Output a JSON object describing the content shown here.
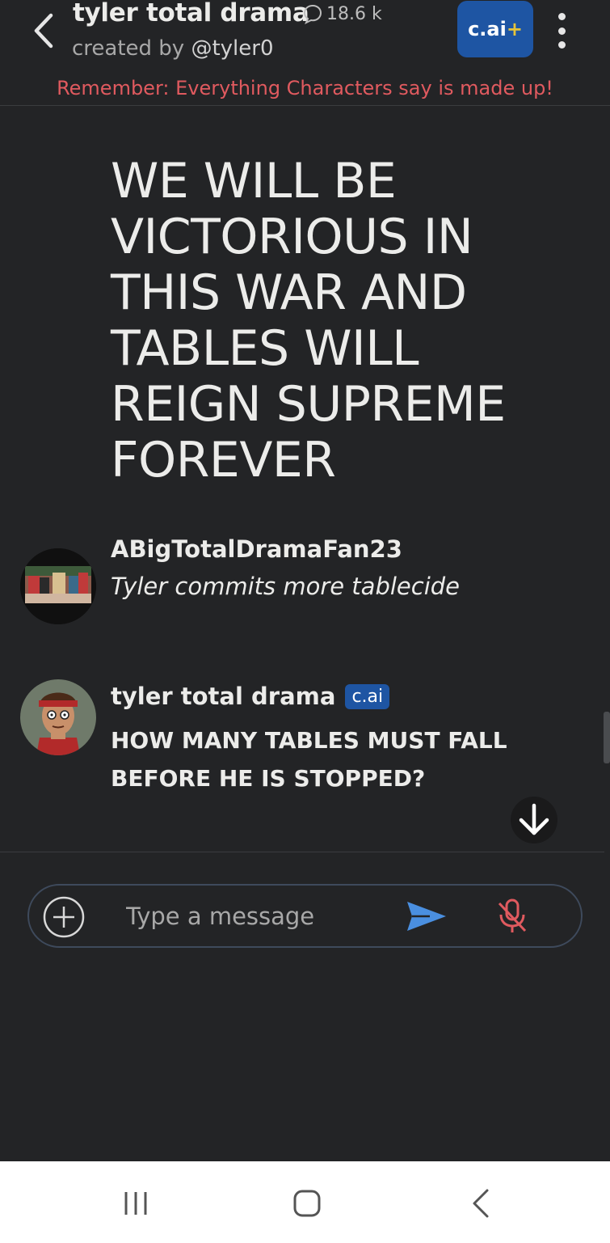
{
  "header": {
    "character_name": "tyler total drama",
    "chat_count": "18.6 k",
    "created_by_prefix": "created by",
    "creator_handle": "@tyler0",
    "subscribe_label": "c.ai",
    "subscribe_plus": "+",
    "disclaimer": "Remember: Everything Characters say is made up!"
  },
  "messages": [
    {
      "type": "bot-large",
      "text": "WE WILL BE VICTORIOUS IN THIS WAR AND TABLES WILL REIGN SUPREME FOREVER"
    },
    {
      "type": "user",
      "sender": "ABigTotalDramaFan23",
      "text": "Tyler commits more tablecide"
    },
    {
      "type": "bot",
      "sender": "tyler total drama",
      "badge": "c.ai",
      "text": "HOW MANY TABLES MUST FALL BEFORE HE IS STOPPED?"
    }
  ],
  "composer": {
    "placeholder": "Type a message"
  },
  "icons": {
    "back": "chevron-left-icon",
    "chat": "chat-bubble-icon",
    "menu": "kebab-menu-icon",
    "scroll": "arrow-down-icon",
    "add": "plus-circle-icon",
    "send": "send-icon",
    "mic": "mic-off-icon"
  },
  "colors": {
    "background": "#232426",
    "accent": "#1e55a3",
    "disclaimer": "#e05a5f",
    "send": "#4a8fe0",
    "mic_off": "#e05a5f"
  }
}
